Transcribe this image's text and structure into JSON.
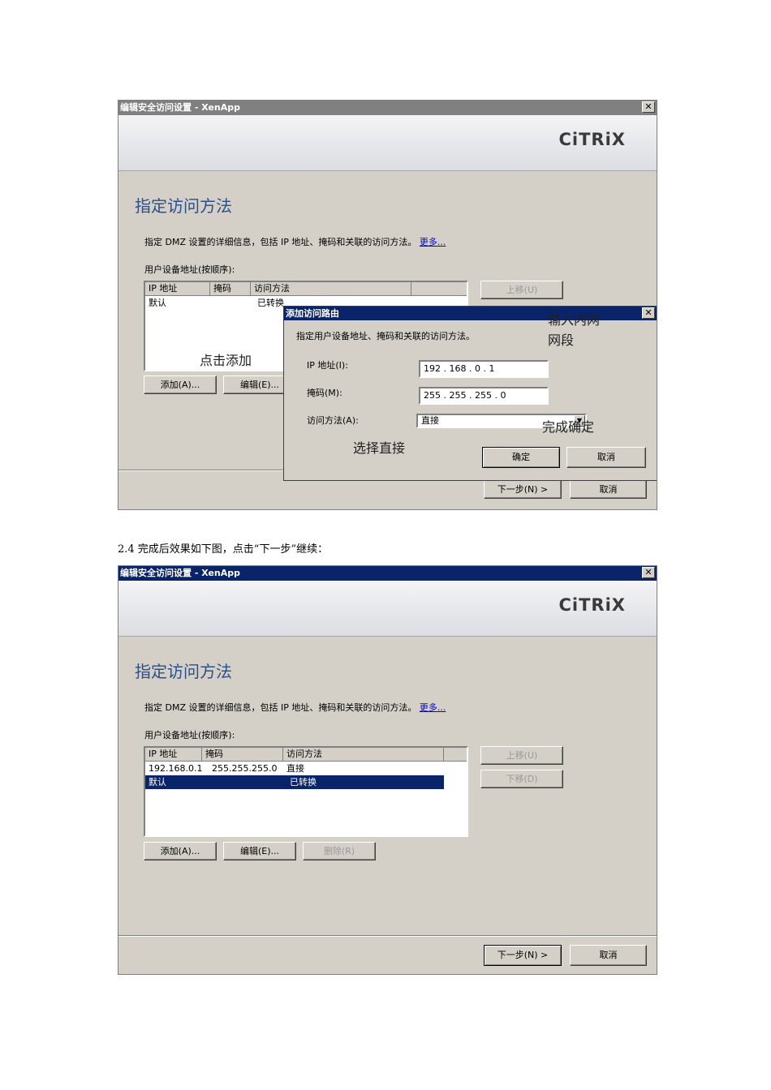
{
  "shot1": {
    "window_title": "编辑安全访问设置 - XenApp",
    "close_glyph": "✕",
    "logo": "CiTRiX",
    "heading": "指定访问方法",
    "description": "指定 DMZ 设置的详细信息，包括 IP 地址、掩码和关联的访问方法。",
    "more_link": "更多...",
    "list_label": "用户设备地址(按顺序):",
    "columns": [
      "IP 地址",
      "掩码",
      "访问方法"
    ],
    "rows": [
      {
        "ip": "默认",
        "mask": "",
        "method": "已转换"
      }
    ],
    "buttons": {
      "move_up": "上移(U)",
      "add": "添加(A)...",
      "edit": "编辑(E)...",
      "next": "下一步(N) >",
      "cancel": "取消"
    },
    "dialog": {
      "title": "添加访问路由",
      "description": "指定用户设备地址、掩码和关联的访问方法。",
      "ip_label": "IP 地址(I):",
      "ip_value": "192 . 168 . 0 . 1",
      "mask_label": "掩码(M):",
      "mask_value": "255 . 255 . 255 . 0",
      "method_label": "访问方法(A):",
      "method_value": "直接",
      "ok": "确定",
      "cancel": "取消"
    },
    "annotations": {
      "click_add": "点击添加",
      "enter_subnet_line1": "输入内网",
      "enter_subnet_line2": "网段",
      "choose_direct": "选择直接",
      "finish_ok": "完成确定"
    }
  },
  "caption": "2.4  完成后效果如下图，点击“下一步”继续：",
  "shot2": {
    "window_title": "编辑安全访问设置 - XenApp",
    "close_glyph": "✕",
    "logo": "CiTRiX",
    "heading": "指定访问方法",
    "description": "指定 DMZ 设置的详细信息，包括 IP 地址、掩码和关联的访问方法。",
    "more_link": "更多...",
    "list_label": "用户设备地址(按顺序):",
    "columns": [
      "IP 地址",
      "掩码",
      "访问方法"
    ],
    "rows": [
      {
        "ip": "192.168.0.1",
        "mask": "255.255.255.0",
        "method": "直接"
      },
      {
        "ip": "默认",
        "mask": "",
        "method": "已转换"
      }
    ],
    "buttons": {
      "move_up": "上移(U)",
      "move_down": "下移(D)",
      "add": "添加(A)...",
      "edit": "编辑(E)...",
      "delete": "删除(R)",
      "next": "下一步(N) >",
      "cancel": "取消"
    }
  }
}
